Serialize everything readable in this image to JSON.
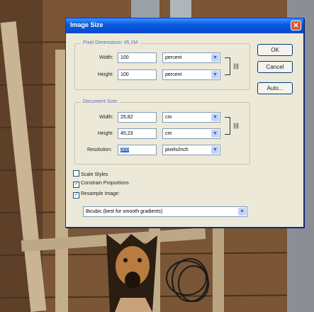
{
  "dialog": {
    "title": "Image Size",
    "close_glyph": "✕",
    "pixel_dimensions": {
      "legend": "Pixel Dimensions: 45,1M",
      "width_label": "Width:",
      "width_value": "100",
      "width_unit": "percent",
      "height_label": "Height:",
      "height_value": "100",
      "height_unit": "percent"
    },
    "document_size": {
      "legend": "Document Size:",
      "width_label": "Width:",
      "width_value": "25,82",
      "width_unit": "cm",
      "height_label": "Height:",
      "height_value": "45,23",
      "height_unit": "cm",
      "resolution_label": "Resolution:",
      "resolution_value": "300",
      "resolution_unit": "pixels/inch"
    },
    "checkboxes": {
      "scale_styles": "Scale Styles",
      "constrain_proportions": "Constrain Proportions",
      "resample_image": "Resample Image:"
    },
    "resample_method": "Bicubic (best for smooth gradients)",
    "buttons": {
      "ok": "OK",
      "cancel": "Cancel",
      "auto": "Auto..."
    },
    "link_icon": "chain-link-icon"
  },
  "colors": {
    "titlebar": "#0a5bde",
    "dialog_bg": "#ece9d8",
    "accent": "#5a6ec0"
  }
}
